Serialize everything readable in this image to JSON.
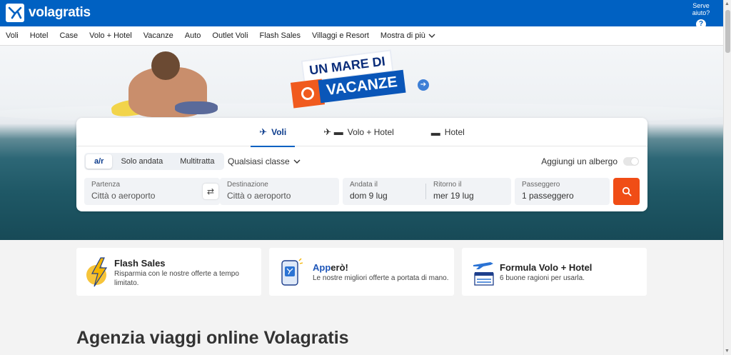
{
  "header": {
    "brand": "volagratis",
    "help_label": "Serve aiuto?",
    "help_icon": "?"
  },
  "nav": {
    "items": [
      {
        "label": "Voli"
      },
      {
        "label": "Hotel"
      },
      {
        "label": "Case"
      },
      {
        "label": "Volo + Hotel"
      },
      {
        "label": "Vacanze"
      },
      {
        "label": "Auto"
      },
      {
        "label": "Outlet Voli"
      },
      {
        "label": "Flash Sales"
      },
      {
        "label": "Villaggi e Resort"
      },
      {
        "label": "Mostra di più"
      }
    ]
  },
  "banner": {
    "line1": "UN MARE DI",
    "line2": "VACANZE"
  },
  "search": {
    "tabs": [
      {
        "label": "Voli",
        "icon": "plane-icon"
      },
      {
        "label": "Volo + Hotel",
        "icon": "plane-bed-icon"
      },
      {
        "label": "Hotel",
        "icon": "bed-icon"
      }
    ],
    "trip_types": [
      "a/r",
      "Solo andata",
      "Multitratta"
    ],
    "selected_trip_type": "a/r",
    "class_label": "Qualsiasi classe",
    "add_hotel_label": "Aggiungi un albergo",
    "add_hotel_enabled": false,
    "departure": {
      "label": "Partenza",
      "placeholder": "Città o aeroporto"
    },
    "destination": {
      "label": "Destinazione",
      "placeholder": "Città o aeroporto"
    },
    "outbound": {
      "label": "Andata il",
      "value": "dom 9 lug"
    },
    "return": {
      "label": "Ritorno il",
      "value": "mer 19 lug"
    },
    "passengers": {
      "label": "Passeggero",
      "value": "1 passeggero"
    }
  },
  "promos": [
    {
      "title": "Flash Sales",
      "desc_line1": "Risparmia con le nostre offerte a tempo",
      "desc_line2": "limitato.",
      "icon": "lightning-icon"
    },
    {
      "title_prefix": "App",
      "title_suffix": "erò!",
      "desc": "Le nostre migliori offerte a portata di mano.",
      "icon": "phone-app-icon"
    },
    {
      "title": "Formula Volo + Hotel",
      "desc": "6 buone ragioni per usarla.",
      "icon": "plane-hotel-icon"
    }
  ],
  "headline": "Agenzia viaggi online Volagratis",
  "colors": {
    "brand_blue": "#0061c2",
    "accent_orange": "#f04d16"
  }
}
